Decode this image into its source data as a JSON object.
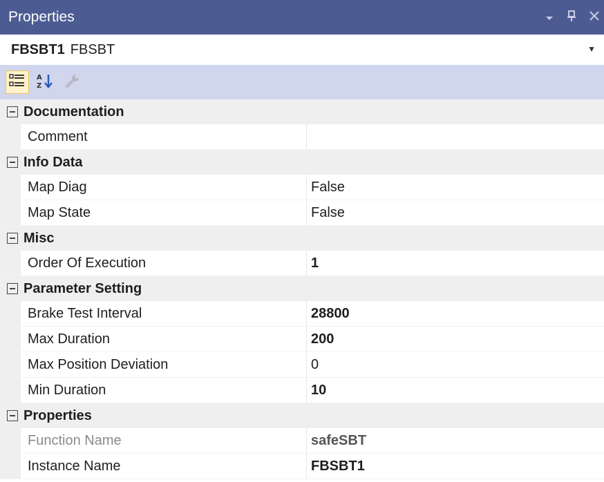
{
  "window": {
    "title": "Properties",
    "controls": [
      "dropdown-icon",
      "pin-icon",
      "close-icon"
    ]
  },
  "selector": {
    "object_name": "FBSBT1",
    "object_type": "FBSBT"
  },
  "toolbar": {
    "buttons": [
      "categorized-icon",
      "alphabetical-sort-icon",
      "property-pages-icon"
    ]
  },
  "categories": [
    {
      "label": "Documentation",
      "properties": [
        {
          "name": "Comment",
          "value": "",
          "bold": false
        }
      ]
    },
    {
      "label": "Info Data",
      "properties": [
        {
          "name": "Map Diag",
          "value": "False",
          "bold": false
        },
        {
          "name": "Map State",
          "value": "False",
          "bold": false
        }
      ]
    },
    {
      "label": "Misc",
      "properties": [
        {
          "name": "Order Of Execution",
          "value": "1",
          "bold": true
        }
      ]
    },
    {
      "label": "Parameter Setting",
      "properties": [
        {
          "name": "Brake Test Interval",
          "value": "28800",
          "bold": true
        },
        {
          "name": "Max Duration",
          "value": "200",
          "bold": true
        },
        {
          "name": "Max Position Deviation",
          "value": "0",
          "bold": false
        },
        {
          "name": "Min Duration",
          "value": "10",
          "bold": true
        }
      ]
    },
    {
      "label": "Properties",
      "properties": [
        {
          "name": "Function Name",
          "value": "safeSBT",
          "bold": true,
          "readonly": true
        },
        {
          "name": "Instance Name",
          "value": "FBSBT1",
          "bold": true
        }
      ]
    }
  ],
  "colors": {
    "titlebar": "#4d5b93",
    "toolbar": "#cfd6ee",
    "category_bg": "#efefef"
  }
}
